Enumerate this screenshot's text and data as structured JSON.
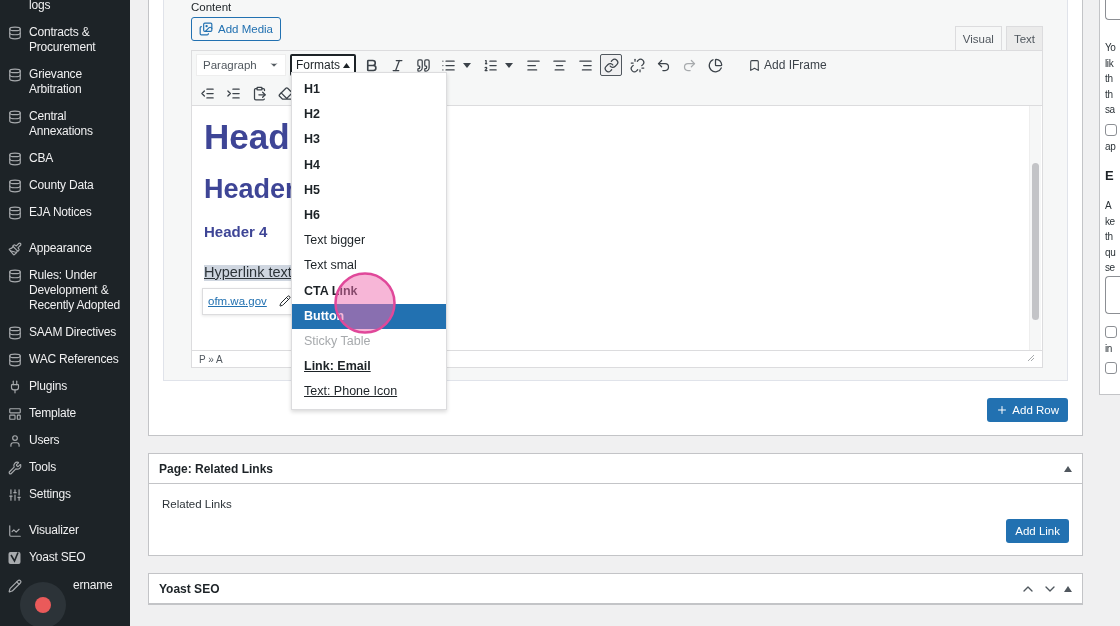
{
  "sidebar": {
    "groups": [
      [
        {
          "label": "logs",
          "kind": "none"
        },
        {
          "label": "Contracts & Procurement",
          "kind": "database"
        },
        {
          "label": "Grievance Arbitration",
          "kind": "database"
        },
        {
          "label": "Central Annexations",
          "kind": "database"
        },
        {
          "label": "CBA",
          "kind": "database"
        },
        {
          "label": "County Data",
          "kind": "database"
        },
        {
          "label": "EJA Notices",
          "kind": "database"
        }
      ],
      [
        {
          "label": "Appearance",
          "kind": "brush"
        },
        {
          "label": "Rules: Under Development & Recently Adopted",
          "kind": "database"
        },
        {
          "label": "SAAM Directives",
          "kind": "database"
        },
        {
          "label": "WAC References",
          "kind": "database"
        },
        {
          "label": "Plugins",
          "kind": "plug"
        },
        {
          "label": "Template",
          "kind": "template"
        },
        {
          "label": "Users",
          "kind": "user"
        },
        {
          "label": "Tools",
          "kind": "wrench"
        },
        {
          "label": "Settings",
          "kind": "sliders"
        }
      ],
      [
        {
          "label": "Visualizer",
          "kind": "chart"
        },
        {
          "label": "Yoast SEO",
          "kind": "yoast"
        },
        {
          "label": "ername",
          "kind": "pencil"
        }
      ]
    ]
  },
  "editor": {
    "label": "Content",
    "add_media": "Add Media",
    "tabs": [
      {
        "label": "Visual",
        "selected": true
      },
      {
        "label": "Text",
        "selected": false
      }
    ],
    "toolbar": {
      "row_1": [
        {
          "kind": "select",
          "label": "Paragraph"
        },
        {
          "kind": "menu",
          "label": "Formats",
          "expanded": true
        },
        {
          "kind": "bold",
          "active": false,
          "disabled": false
        },
        {
          "kind": "italic",
          "active": false,
          "disabled": false
        },
        {
          "kind": "quote",
          "active": false,
          "disabled": false
        },
        {
          "kind": "bullets",
          "active": false,
          "disabled": false
        },
        {
          "kind": "numbers",
          "active": false,
          "disabled": false
        },
        {
          "kind": "align_left",
          "active": false,
          "disabled": false
        },
        {
          "kind": "align_center",
          "active": false,
          "disabled": false
        },
        {
          "kind": "align_right",
          "active": false,
          "disabled": false
        },
        {
          "kind": "link",
          "active": true,
          "disabled": false
        },
        {
          "kind": "unlink",
          "active": false,
          "disabled": false
        },
        {
          "kind": "undo",
          "active": false,
          "disabled": false
        },
        {
          "kind": "redo",
          "active": false,
          "disabled": true
        },
        {
          "kind": "chart",
          "active": false,
          "disabled": false
        },
        {
          "kind": "iframe",
          "label": "Add IFrame"
        }
      ],
      "row_2": [
        {
          "kind": "outdent"
        },
        {
          "kind": "indent"
        },
        {
          "kind": "paste"
        },
        {
          "kind": "eraser"
        }
      ]
    },
    "formats_menu": [
      {
        "label": "H1",
        "kind": "bold",
        "selected": false,
        "disabled": false
      },
      {
        "label": "H2",
        "kind": "bold",
        "selected": false,
        "disabled": false
      },
      {
        "label": "H3",
        "kind": "bold",
        "selected": false,
        "disabled": false
      },
      {
        "label": "H4",
        "kind": "bold",
        "selected": false,
        "disabled": false
      },
      {
        "label": "H5",
        "kind": "bold",
        "selected": false,
        "disabled": false
      },
      {
        "label": "H6",
        "kind": "bold",
        "selected": false,
        "disabled": false
      },
      {
        "label": "Text bigger",
        "kind": "normal",
        "selected": false,
        "disabled": false
      },
      {
        "label": "Text smal",
        "kind": "normal",
        "selected": false,
        "disabled": false
      },
      {
        "label": "CTA Link",
        "kind": "bold",
        "selected": false,
        "disabled": false
      },
      {
        "label": "Button",
        "kind": "bold",
        "selected": true,
        "disabled": false
      },
      {
        "label": "Sticky Table",
        "kind": "normal",
        "selected": false,
        "disabled": true
      },
      {
        "label": "Link: Email",
        "kind": "bold_underline",
        "selected": false,
        "disabled": false
      },
      {
        "label": "Text: Phone Icon",
        "kind": "underline",
        "selected": false,
        "disabled": false
      }
    ],
    "content": [
      {
        "kind": "h1",
        "text": "Head"
      },
      {
        "kind": "h2",
        "text": "Header"
      },
      {
        "kind": "h4",
        "text": "Header 4"
      },
      {
        "kind": "link",
        "text": "Hyperlink text",
        "selected": true
      }
    ],
    "link_tooltip": {
      "url": "ofm.wa.gov"
    },
    "status_path": "P » A"
  },
  "add_row": "Add Row",
  "related_links": {
    "title": "Page: Related Links",
    "label": "Related Links",
    "button": "Add Link"
  },
  "yoast": {
    "title": "Yoast SEO"
  },
  "right_panel": [
    {
      "kind": "box"
    },
    {
      "kind": "text",
      "text": "Yo"
    },
    {
      "kind": "text",
      "text": "lik"
    },
    {
      "kind": "text",
      "text": "th"
    },
    {
      "kind": "text",
      "text": "th"
    },
    {
      "kind": "text",
      "text": "sa"
    },
    {
      "kind": "checkbox",
      "checked": false
    },
    {
      "kind": "text",
      "text": "ap"
    },
    {
      "kind": "heading",
      "text": "E"
    },
    {
      "kind": "text",
      "text": "A"
    },
    {
      "kind": "text",
      "text": "ke"
    },
    {
      "kind": "text",
      "text": "th"
    },
    {
      "kind": "text",
      "text": "qu"
    },
    {
      "kind": "text",
      "text": "se"
    },
    {
      "kind": "box"
    },
    {
      "kind": "checkbox",
      "checked": false
    },
    {
      "kind": "text",
      "text": "in"
    },
    {
      "kind": "checkbox",
      "checked": false
    }
  ]
}
